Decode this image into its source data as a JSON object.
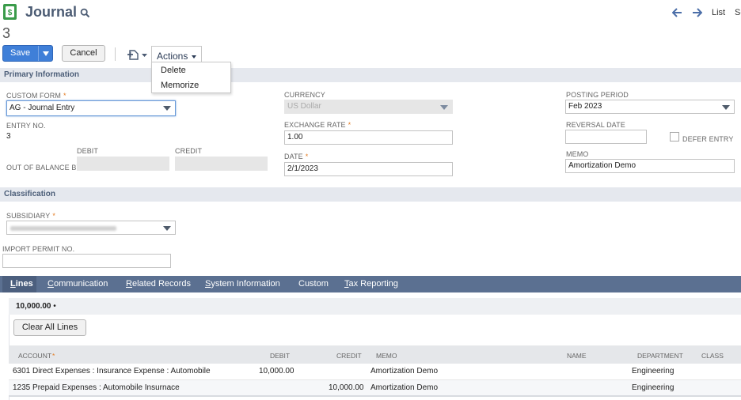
{
  "header": {
    "title": "Journal",
    "record_number": "3",
    "nav_list": "List",
    "nav_search_cut": "Se"
  },
  "toolbar": {
    "save_label": "Save",
    "cancel_label": "Cancel",
    "actions_label": "Actions",
    "actions_menu": [
      "Delete",
      "Memorize"
    ]
  },
  "primary": {
    "section_title": "Primary Information",
    "custom_form_label": "CUSTOM FORM",
    "custom_form_value": "AG - Journal Entry",
    "entry_no_label": "ENTRY NO.",
    "entry_no_value": "3",
    "debit_label": "DEBIT",
    "credit_label": "CREDIT",
    "out_of_balance_label": "OUT OF BALANCE BY",
    "currency_label": "CURRENCY",
    "currency_value": "US Dollar",
    "exchange_rate_label": "EXCHANGE RATE",
    "exchange_rate_value": "1.00",
    "date_label": "DATE",
    "date_value": "2/1/2023",
    "posting_period_label": "POSTING PERIOD",
    "posting_period_value": "Feb 2023",
    "reversal_date_label": "REVERSAL DATE",
    "defer_entry_label": "DEFER ENTRY",
    "memo_label": "MEMO",
    "memo_value": "Amortization Demo"
  },
  "classification": {
    "section_title": "Classification",
    "subsidiary_label": "SUBSIDIARY",
    "import_permit_label": "IMPORT PERMIT NO."
  },
  "tabs": [
    {
      "label": "Lines",
      "underline": "L",
      "rest": "ines"
    },
    {
      "label": "Communication",
      "underline": "C",
      "rest": "ommunication"
    },
    {
      "label": "Related Records",
      "underline": "R",
      "rest": "elated Records"
    },
    {
      "label": "System Information",
      "underline": "S",
      "rest": "ystem Information"
    },
    {
      "label": "Custom",
      "underline": "C",
      "rest": "ustom",
      "pre": "",
      "alt": "Cu"
    },
    {
      "label": "Tax Reporting",
      "underline": "T",
      "rest": "ax Reporting"
    }
  ],
  "lines": {
    "total": "10,000.00",
    "clear_all_label": "Clear All Lines",
    "columns": [
      "ACCOUNT",
      "DEBIT",
      "CREDIT",
      "MEMO",
      "NAME",
      "DEPARTMENT",
      "CLASS"
    ],
    "rows": [
      {
        "account": "6301 Direct Expenses : Insurance Expense : Automobile",
        "debit": "10,000.00",
        "credit": "",
        "memo": "Amortization Demo",
        "name": "",
        "department": "Engineering",
        "class": ""
      },
      {
        "account": "1235 Prepaid Expenses : Automobile Insurnace",
        "debit": "",
        "credit": "10,000.00",
        "memo": "Amortization Demo",
        "name": "",
        "department": "Engineering",
        "class": ""
      }
    ]
  },
  "colors": {
    "accent_blue": "#3f7fd8",
    "tab_bar": "#5b7091",
    "section_bar": "#e5e8ee",
    "required": "#e37b22",
    "app_icon": "#3a9b4a"
  }
}
